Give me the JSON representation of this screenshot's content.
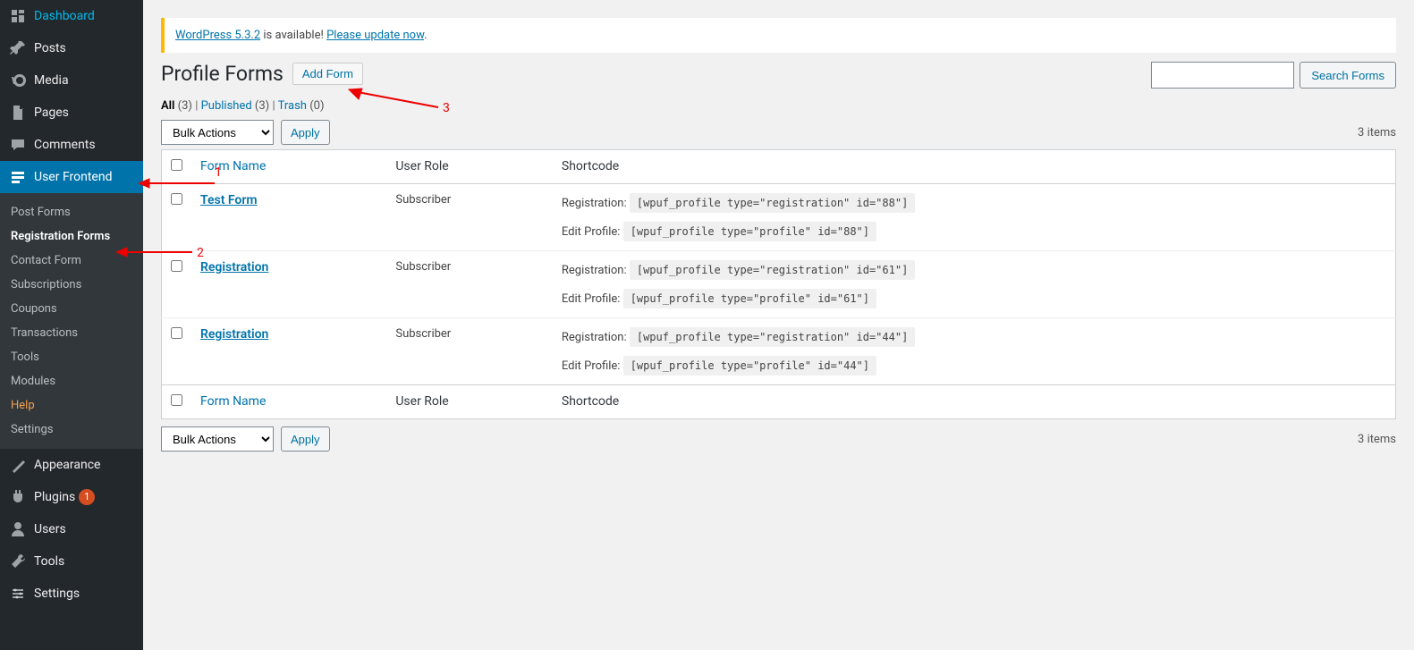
{
  "sidebar": {
    "items": [
      {
        "icon": "dashboard",
        "label": "Dashboard"
      },
      {
        "icon": "pin",
        "label": "Posts"
      },
      {
        "icon": "media",
        "label": "Media"
      },
      {
        "icon": "page",
        "label": "Pages"
      },
      {
        "icon": "comment",
        "label": "Comments"
      },
      {
        "icon": "frontend",
        "label": "User Frontend",
        "current": true
      },
      {
        "icon": "appearance",
        "label": "Appearance"
      },
      {
        "icon": "plugin",
        "label": "Plugins",
        "badge": "1"
      },
      {
        "icon": "users",
        "label": "Users"
      },
      {
        "icon": "tools",
        "label": "Tools"
      },
      {
        "icon": "settings",
        "label": "Settings"
      }
    ],
    "submenu": [
      {
        "label": "Post Forms"
      },
      {
        "label": "Registration Forms",
        "active": true
      },
      {
        "label": "Contact Form"
      },
      {
        "label": "Subscriptions"
      },
      {
        "label": "Coupons"
      },
      {
        "label": "Transactions"
      },
      {
        "label": "Tools"
      },
      {
        "label": "Modules"
      },
      {
        "label": "Help",
        "highlight": true
      },
      {
        "label": "Settings"
      }
    ]
  },
  "notice": {
    "prefix_link": "WordPress 5.3.2",
    "mid": " is available! ",
    "link": "Please update now",
    "suffix": "."
  },
  "header": {
    "title": "Profile Forms",
    "add_btn": "Add Form"
  },
  "filters": {
    "all": "All",
    "all_count": "(3)",
    "published": "Published",
    "published_count": "(3)",
    "trash": "Trash",
    "trash_count": "(0)"
  },
  "bulk": {
    "label": "Bulk Actions",
    "apply": "Apply"
  },
  "count_text": "3 items",
  "search_btn": "Search Forms",
  "table": {
    "headers": {
      "name": "Form Name",
      "role": "User Role",
      "shortcode": "Shortcode"
    },
    "rows": [
      {
        "name": "Test Form",
        "role": "Subscriber",
        "reg_label": "Registration:",
        "reg_code": "[wpuf_profile type=\"registration\" id=\"88\"]",
        "prof_label": "Edit Profile:",
        "prof_code": "[wpuf_profile type=\"profile\" id=\"88\"]"
      },
      {
        "name": "Registration",
        "role": "Subscriber",
        "reg_label": "Registration:",
        "reg_code": "[wpuf_profile type=\"registration\" id=\"61\"]",
        "prof_label": "Edit Profile:",
        "prof_code": "[wpuf_profile type=\"profile\" id=\"61\"]"
      },
      {
        "name": "Registration",
        "role": "Subscriber",
        "reg_label": "Registration:",
        "reg_code": "[wpuf_profile type=\"registration\" id=\"44\"]",
        "prof_label": "Edit Profile:",
        "prof_code": "[wpuf_profile type=\"profile\" id=\"44\"]"
      }
    ]
  },
  "annotations": {
    "one": "1",
    "two": "2",
    "three": "3"
  }
}
